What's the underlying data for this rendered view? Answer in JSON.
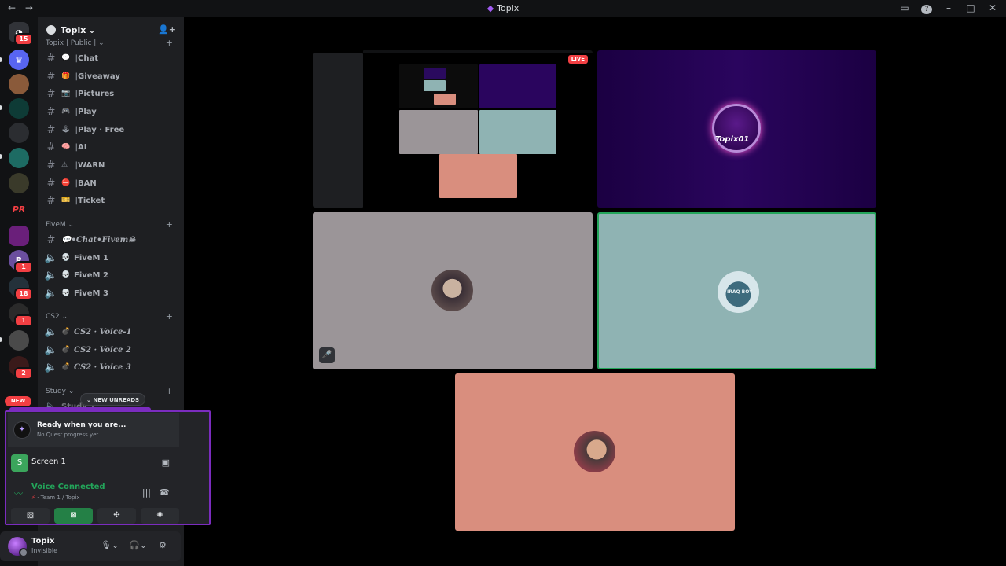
{
  "window": {
    "title": "Topix",
    "back": "←",
    "forward": "→",
    "inbox_icon": "inbox-icon",
    "help_icon": "help-icon"
  },
  "servers": {
    "home_badge": "15",
    "badges": [
      "1",
      "18",
      "1",
      "2"
    ],
    "new_label": "NEW",
    "pr_label": "PR"
  },
  "guild": {
    "name": "Topix"
  },
  "categories": [
    {
      "name": "Topix | Public |"
    },
    {
      "name": "FiveM"
    },
    {
      "name": "CS2"
    },
    {
      "name": "Study"
    }
  ],
  "channels": [
    {
      "emoji": "💬",
      "label": "Chat"
    },
    {
      "emoji": "🎁",
      "label": "Giveaway"
    },
    {
      "emoji": "📷",
      "label": "Pictures"
    },
    {
      "emoji": "🎮",
      "label": "Play"
    },
    {
      "emoji": "🕹",
      "label": "Play · Free"
    },
    {
      "emoji": "🧠",
      "label": "AI"
    },
    {
      "emoji": "⚠",
      "label": "WARN"
    },
    {
      "emoji": "⛔",
      "label": "BAN"
    },
    {
      "emoji": "🎫",
      "label": "Ticket"
    }
  ],
  "fivem_channels": [
    {
      "label": "💬•Chat•Fivem☠"
    },
    {
      "emoji": "💀",
      "label": "FiveM 1"
    },
    {
      "emoji": "💀",
      "label": "FiveM 2"
    },
    {
      "emoji": "💀",
      "label": "FiveM 3"
    }
  ],
  "cs2_channels": [
    {
      "emoji": "💣",
      "label": "CS2 · Voice-1"
    },
    {
      "emoji": "💣",
      "label": "CS2 · Voice 2"
    },
    {
      "emoji": "💣",
      "label": "CS2 · Voice 3"
    }
  ],
  "study_channels": [
    {
      "label": "Study 1"
    }
  ],
  "unreads": {
    "label": "NEW UNREADS"
  },
  "quest": {
    "title": "Ready when you are...",
    "subtitle": "No Quest progress yet"
  },
  "screen_share": {
    "label": "Screen 1"
  },
  "voice": {
    "status": "Voice Connected",
    "location": "Team 1 / Topix"
  },
  "user": {
    "name": "Topix",
    "status": "Invisible"
  },
  "stream": {
    "live_label": "LIVE"
  },
  "participants": {
    "topix_label": "Topix01",
    "teal_label": "IRAQ BOY"
  }
}
